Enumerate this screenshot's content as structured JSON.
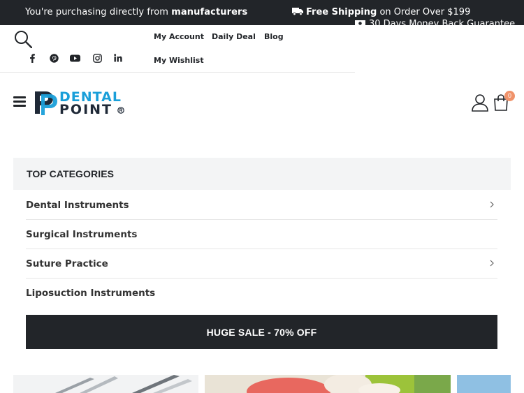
{
  "topbar": {
    "purchasing_prefix": "You're purchasing directly from ",
    "purchasing_bold": "manufacturers",
    "shipping_bold": "Free Shipping",
    "shipping_rest": " on Order Over $199",
    "guarantee": "30 Days Money Back Guarantee"
  },
  "header": {
    "links": [
      "My Account",
      "Daily Deal",
      "Blog",
      "My Wishlist"
    ],
    "social_icons": [
      "facebook-icon",
      "pinterest-icon",
      "youtube-icon",
      "instagram-icon",
      "linkedin-icon"
    ],
    "logo_top": "DENTAL",
    "logo_bottom": "POINT",
    "cart_count": "0"
  },
  "categories": {
    "title": "TOP CATEGORIES",
    "items": [
      {
        "label": "Dental Instruments",
        "has_submenu": true
      },
      {
        "label": "Surgical Instruments",
        "has_submenu": false
      },
      {
        "label": "Suture Practice",
        "has_submenu": true
      },
      {
        "label": "Liposuction Instruments",
        "has_submenu": false
      }
    ],
    "sale_label": "HUGE SALE - 70% OFF"
  },
  "colors": {
    "dark": "#222529",
    "accent_blue": "#1a9fd9",
    "cart_badge": "#f0926a"
  }
}
